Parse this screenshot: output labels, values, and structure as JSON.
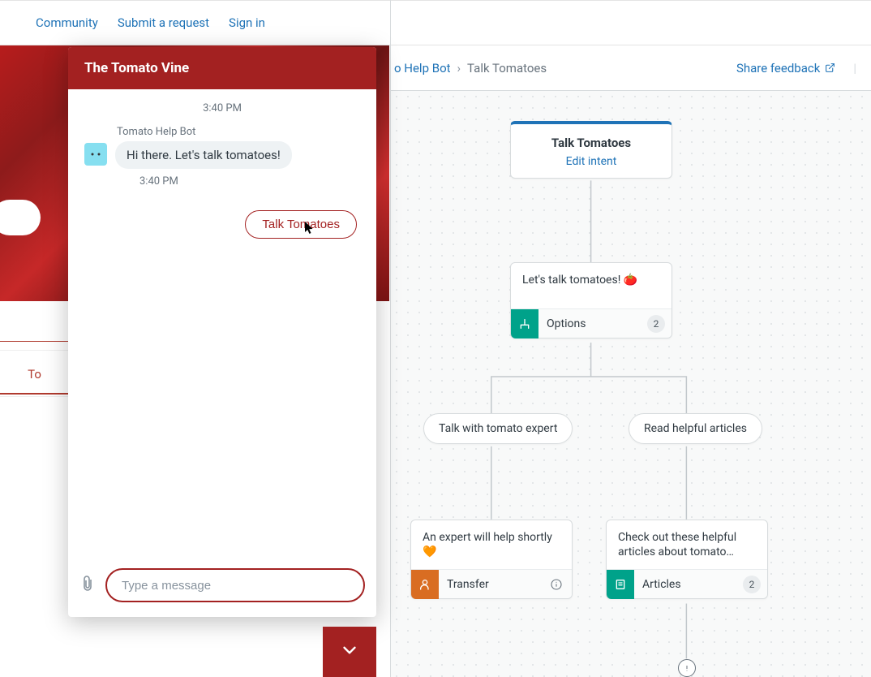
{
  "nav": {
    "community": "Community",
    "submit_request": "Submit a request",
    "sign_in": "Sign in"
  },
  "hero_tab_partial": "To",
  "chat": {
    "title": "The Tomato Vine",
    "time_main": "3:40 PM",
    "bot_name": "Tomato Help Bot",
    "bot_message": "Hi there. Let's talk tomatoes!",
    "time_msg": "3:40 PM",
    "quick_replies": [
      "Talk Tomatoes"
    ],
    "input_placeholder": "Type a message"
  },
  "builder": {
    "breadcrumb": {
      "bot_partial": "o Help Bot",
      "current": "Talk Tomatoes"
    },
    "share_feedback": "Share feedback",
    "root": {
      "title": "Talk Tomatoes",
      "edit_link": "Edit intent"
    },
    "prompt_step": {
      "text": "Let's talk tomatoes! 🍅",
      "type_label": "Options",
      "badge": "2"
    },
    "options": {
      "left": "Talk with tomato expert",
      "right": "Read helpful articles"
    },
    "transfer_step": {
      "text": "An expert will help shortly 🧡",
      "type_label": "Transfer"
    },
    "articles_step": {
      "text": "Check out these helpful articles about tomato…",
      "type_label": "Articles",
      "badge": "2"
    }
  }
}
